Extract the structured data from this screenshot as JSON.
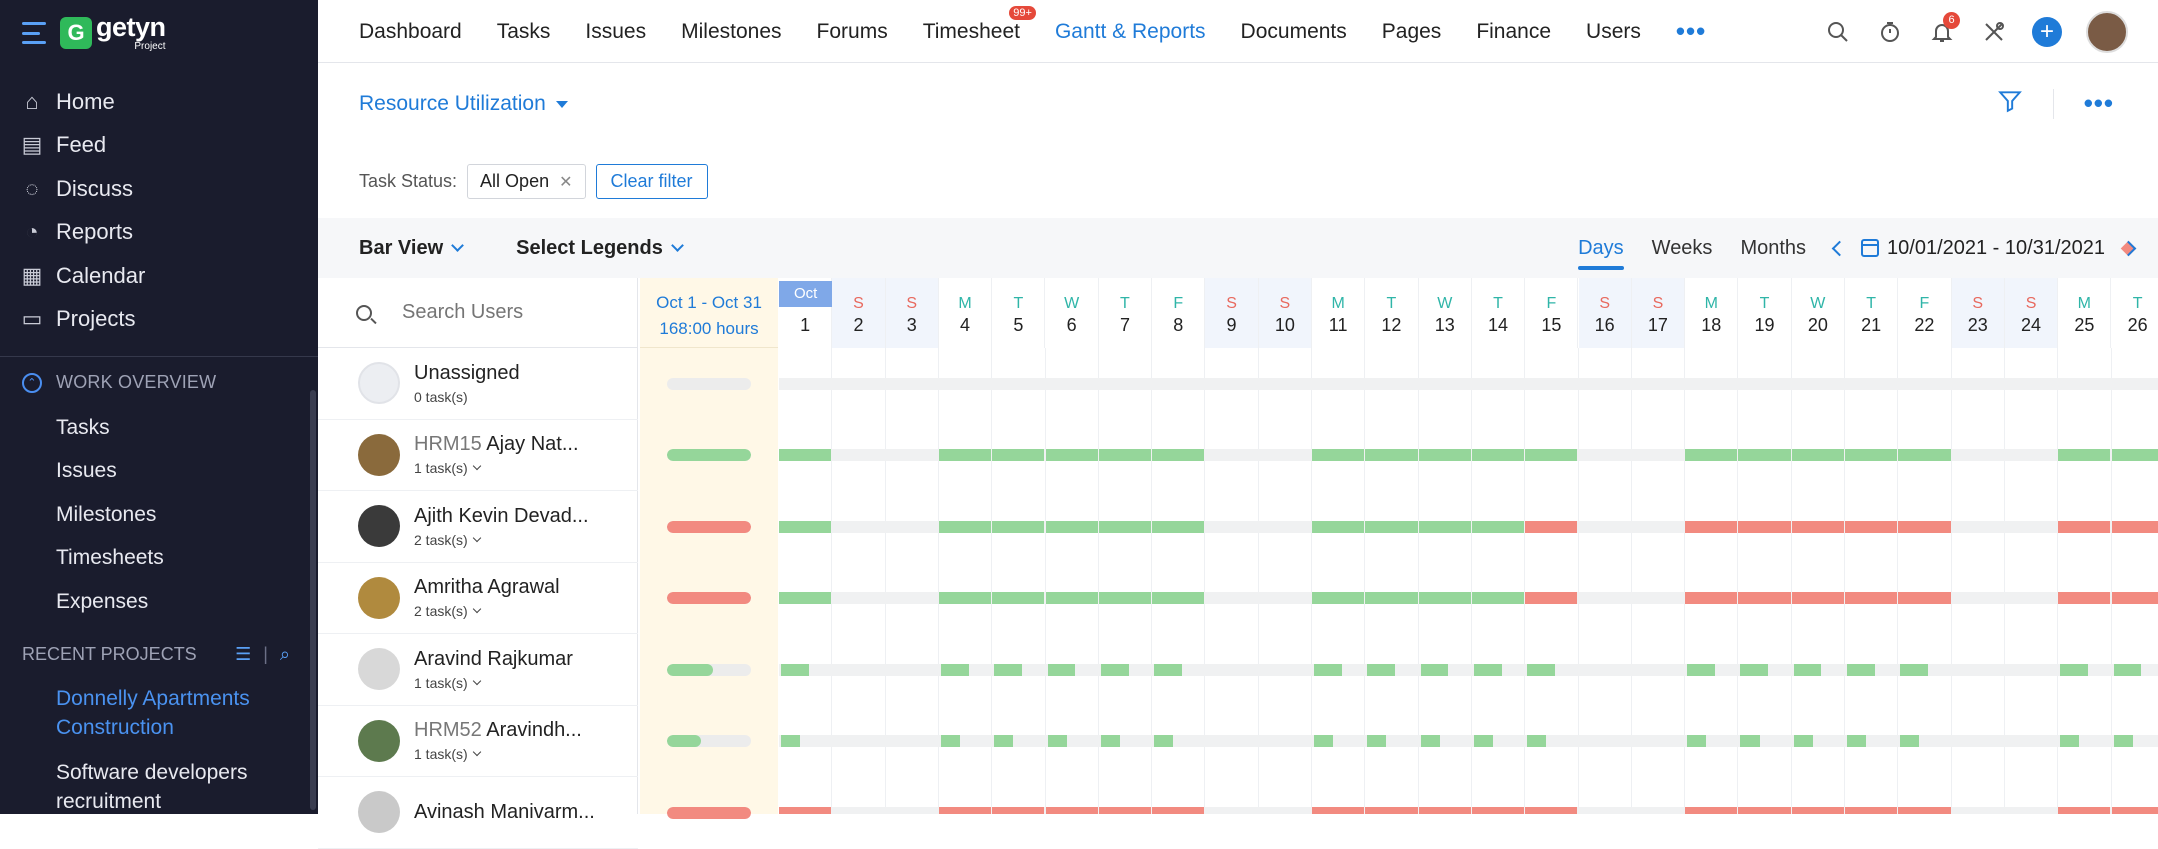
{
  "app": {
    "logo_name": "getyn",
    "logo_sub": "Project"
  },
  "sidebar": {
    "items": [
      {
        "label": "Home",
        "icon": "home-icon",
        "glyph": "⌂"
      },
      {
        "label": "Feed",
        "icon": "feed-icon",
        "glyph": "▤"
      },
      {
        "label": "Discuss",
        "icon": "discuss-icon",
        "glyph": "◌"
      },
      {
        "label": "Reports",
        "icon": "reports-icon",
        "glyph": "◔"
      },
      {
        "label": "Calendar",
        "icon": "calendar-icon",
        "glyph": "▦"
      },
      {
        "label": "Projects",
        "icon": "projects-icon",
        "glyph": "▭"
      }
    ],
    "work_overview_label": "WORK OVERVIEW",
    "work_overview": [
      "Tasks",
      "Issues",
      "Milestones",
      "Timesheets",
      "Expenses"
    ],
    "recent_projects_label": "RECENT PROJECTS",
    "recent_projects": [
      {
        "label": "Donnelly Apartments Construction",
        "active": true
      },
      {
        "label": "Software developers recruitment",
        "active": false
      }
    ]
  },
  "topnav": {
    "tabs": [
      {
        "label": "Dashboard"
      },
      {
        "label": "Tasks"
      },
      {
        "label": "Issues"
      },
      {
        "label": "Milestones"
      },
      {
        "label": "Forums"
      },
      {
        "label": "Timesheet",
        "badge": "99+"
      },
      {
        "label": "Gantt & Reports",
        "active": true
      },
      {
        "label": "Documents"
      },
      {
        "label": "Pages"
      },
      {
        "label": "Finance"
      },
      {
        "label": "Users"
      }
    ],
    "more": "•••",
    "notification_count": "6"
  },
  "page": {
    "title": "Resource Utilization",
    "filter_label": "Task Status:",
    "filter_chip": "All Open",
    "clear_filter": "Clear filter",
    "view": "Bar View",
    "legends": "Select Legends",
    "segments": [
      {
        "label": "Days",
        "active": true
      },
      {
        "label": "Weeks"
      },
      {
        "label": "Months"
      }
    ],
    "date_range": "10/01/2021  -  10/31/2021",
    "search_placeholder": "Search Users",
    "summary_range": "Oct 1 - Oct 31",
    "summary_hours": "168:00 hours",
    "month_tag": "Oct"
  },
  "colors": {
    "accent": "#1f7bd8",
    "green": "#95d69a",
    "red": "#f28a80",
    "weekend": "#e8695e",
    "weekday": "#2fb5a8"
  },
  "days": [
    {
      "l": "",
      "n": "1",
      "we": false
    },
    {
      "l": "S",
      "n": "2",
      "we": true
    },
    {
      "l": "S",
      "n": "3",
      "we": true
    },
    {
      "l": "M",
      "n": "4",
      "we": false
    },
    {
      "l": "T",
      "n": "5",
      "we": false
    },
    {
      "l": "W",
      "n": "6",
      "we": false
    },
    {
      "l": "T",
      "n": "7",
      "we": false
    },
    {
      "l": "F",
      "n": "8",
      "we": false
    },
    {
      "l": "S",
      "n": "9",
      "we": true
    },
    {
      "l": "S",
      "n": "10",
      "we": true
    },
    {
      "l": "M",
      "n": "11",
      "we": false
    },
    {
      "l": "T",
      "n": "12",
      "we": false
    },
    {
      "l": "W",
      "n": "13",
      "we": false
    },
    {
      "l": "T",
      "n": "14",
      "we": false
    },
    {
      "l": "F",
      "n": "15",
      "we": false
    },
    {
      "l": "S",
      "n": "16",
      "we": true
    },
    {
      "l": "S",
      "n": "17",
      "we": true
    },
    {
      "l": "M",
      "n": "18",
      "we": false
    },
    {
      "l": "T",
      "n": "19",
      "we": false
    },
    {
      "l": "W",
      "n": "20",
      "we": false
    },
    {
      "l": "T",
      "n": "21",
      "we": false
    },
    {
      "l": "F",
      "n": "22",
      "we": false
    },
    {
      "l": "S",
      "n": "23",
      "we": true
    },
    {
      "l": "S",
      "n": "24",
      "we": true
    },
    {
      "l": "M",
      "n": "25",
      "we": false
    },
    {
      "l": "T",
      "n": "26",
      "we": false
    }
  ],
  "users": [
    {
      "id": "",
      "name": "Unassigned",
      "tasks": "0 task(s)",
      "expand": false,
      "summary": "none",
      "summary_fill": 0,
      "avatar": "#eceef2",
      "cells": "__________________________"
    },
    {
      "id": "HRM15",
      "name": "Ajay Nat...",
      "tasks": "1 task(s)",
      "expand": true,
      "summary": "green",
      "summary_fill": 1,
      "avatar": "#8a6a3c",
      "cells": "G__GGGGG__GGGGG__GGGGG__GG"
    },
    {
      "id": "",
      "name": "Ajith Kevin Devad...",
      "tasks": "2 task(s)",
      "expand": true,
      "summary": "red",
      "summary_fill": 1,
      "avatar": "#3a3a3a",
      "cells": "G__GGGGG__GGGGR__RRRRR__RR"
    },
    {
      "id": "",
      "name": "Amritha Agrawal",
      "tasks": "2 task(s)",
      "expand": true,
      "summary": "red",
      "summary_fill": 1,
      "avatar": "#b08a3e",
      "cells": "G__GGGGG__GGGGR__RRRRR__RR"
    },
    {
      "id": "",
      "name": "Aravind Rajkumar",
      "tasks": "1 task(s)",
      "expand": true,
      "summary": "green",
      "summary_fill": 0.55,
      "avatar": "#d8d8d8",
      "cells": "h__hhhhh__hhhhh__hhhhh__hh"
    },
    {
      "id": "HRM52",
      "name": "Aravindh...",
      "tasks": "1 task(s)",
      "expand": true,
      "summary": "green",
      "summary_fill": 0.4,
      "avatar": "#5d7a4e",
      "cells": "q__qqqqq__qqqqq__qqqqq__qq"
    },
    {
      "id": "",
      "name": "Avinash Manivarm...",
      "tasks": "",
      "expand": false,
      "summary": "red",
      "summary_fill": 1,
      "avatar": "#c9c9c9",
      "cells": "R__RRRRR__RRRRR__RRRRR__RR"
    }
  ]
}
